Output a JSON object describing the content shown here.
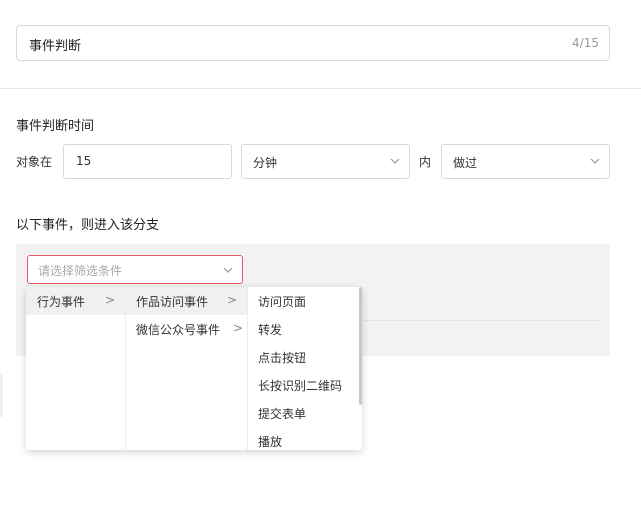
{
  "name_field": {
    "value": "事件判断",
    "counter": "4/15"
  },
  "time_section": {
    "title": "事件判断时间",
    "object_label": "对象在",
    "duration_value": "15",
    "unit_value": "分钟",
    "within_label": "内",
    "action_value": "做过"
  },
  "event_section": {
    "title": "以下事件，则进入该分支",
    "filter_placeholder": "请选择筛选条件"
  },
  "cascader": {
    "col1": [
      {
        "label": "行为事件",
        "arrow": ">"
      }
    ],
    "col2": [
      {
        "label": "作品访问事件",
        "arrow": ">"
      },
      {
        "label": "微信公众号事件",
        "arrow": ">"
      }
    ],
    "col3": [
      "访问页面",
      "转发",
      "点击按钮",
      "长按识别二维码",
      "提交表单",
      "播放"
    ]
  },
  "colors": {
    "accent_error": "#e25a6a",
    "panel_bg": "#f2f2f2"
  }
}
